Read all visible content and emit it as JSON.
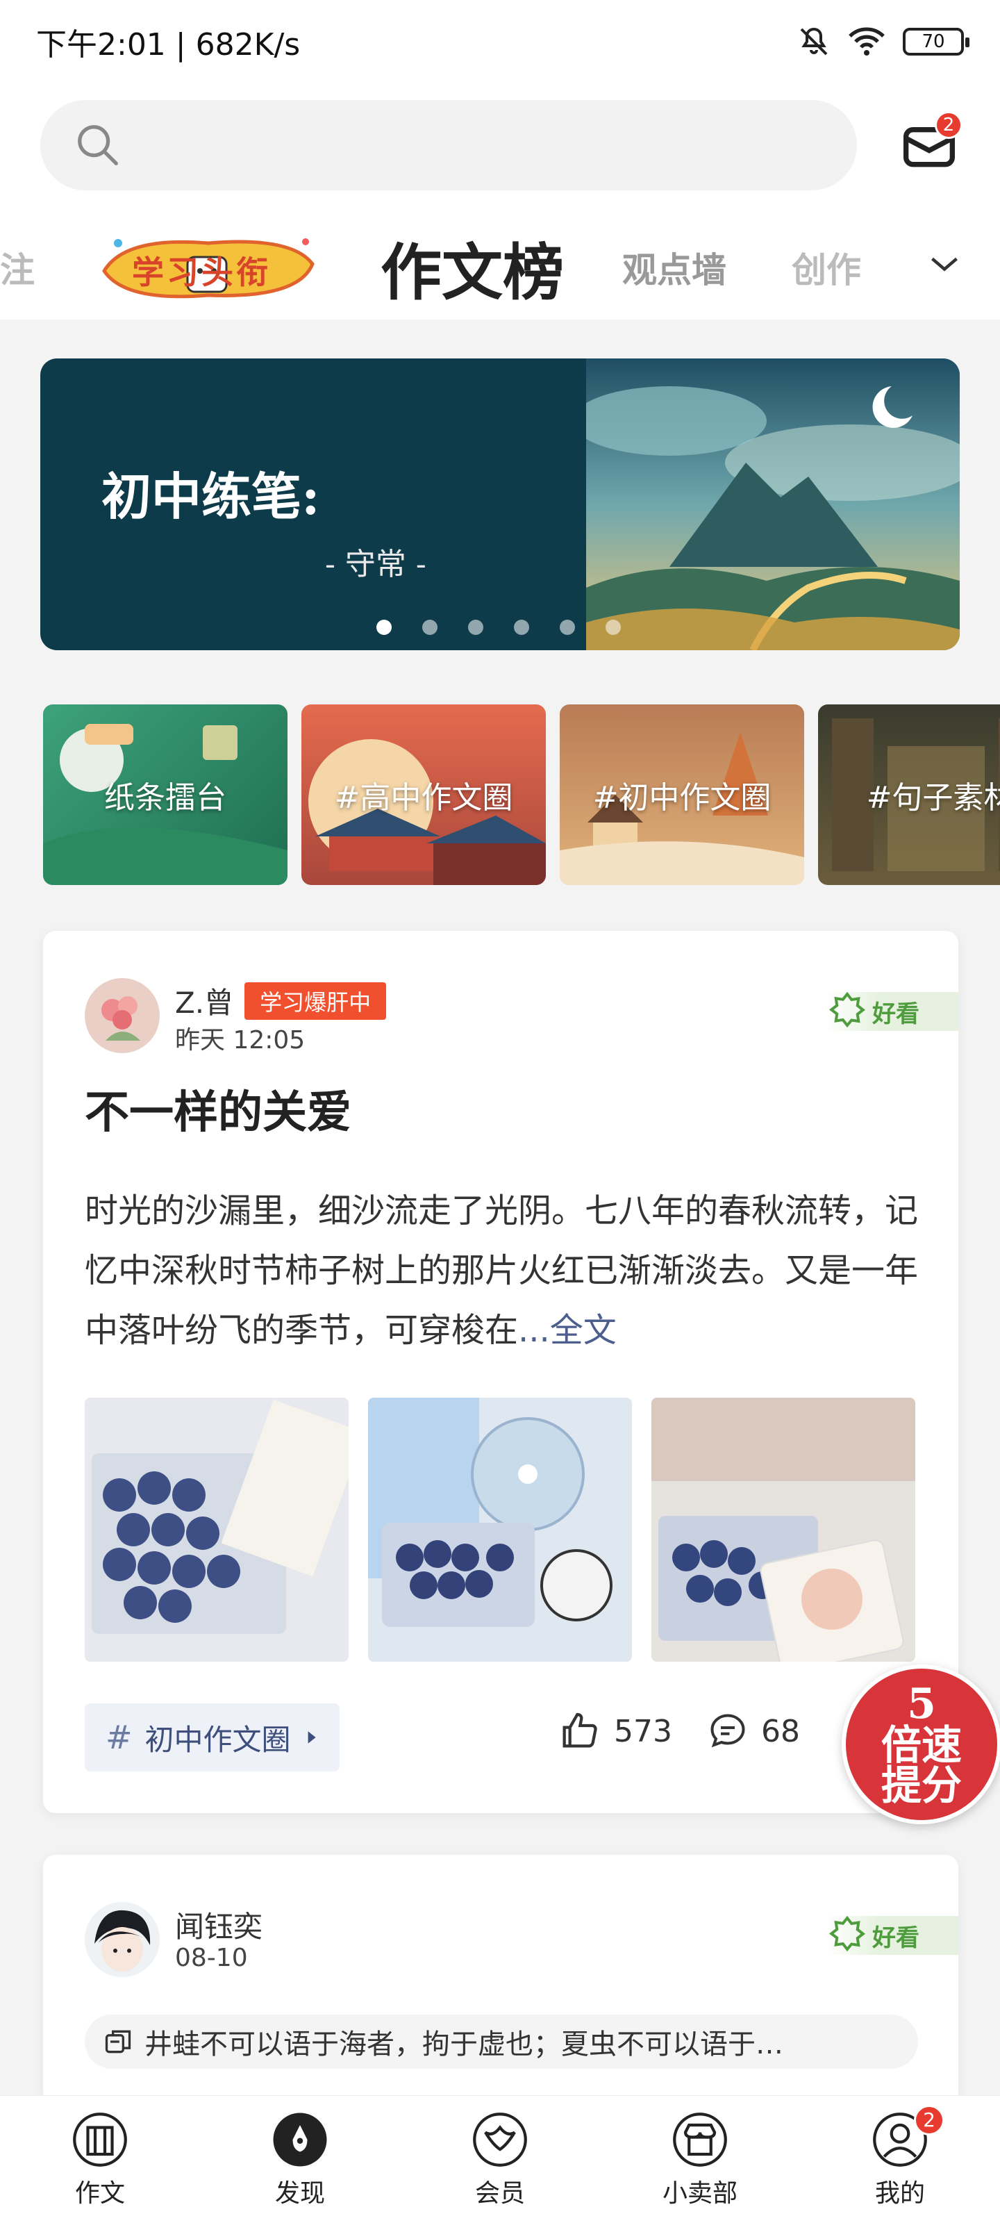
{
  "status_bar": {
    "time_speed": "下午2:01 | 682K/s",
    "battery": "70"
  },
  "header": {
    "mail_badge": "2",
    "logo_text": "学习头衔",
    "tabs": {
      "left_partial": "注",
      "active": "作文榜",
      "second": "观点墙",
      "third_partial": "创作"
    }
  },
  "banner": {
    "title": "初中练笔:",
    "subtitle": "- 守常 -",
    "dot_count": 6,
    "active_dot": 0
  },
  "topics": [
    {
      "label": "纸条擂台"
    },
    {
      "label": "#高中作文圈"
    },
    {
      "label": "#初中作文圈"
    },
    {
      "label": "#句子素材"
    }
  ],
  "post1": {
    "author": "Z.曾",
    "author_badge": "学习爆肝中",
    "time": "昨天 12:05",
    "good_tag": "好看",
    "title": "不一样的关爱",
    "text": "时光的沙漏里，细沙流走了光阴。七八年的春秋流转，记忆中深秋时节柿子树上的那片火红已渐渐淡去。又是一年中落叶纷飞的季节，可穿梭在",
    "more": "...全文",
    "topic_chip": "初中作文圈",
    "likes": "573",
    "comments": "68"
  },
  "post2": {
    "author": "闻钰奕",
    "time": "08-10",
    "good_tag": "好看",
    "quote": "井蛙不可以语于海者，拘于虚也；夏虫不可以语于…"
  },
  "boost": {
    "num": "5",
    "line1": "倍速",
    "line2": "提分"
  },
  "bottom_nav": [
    {
      "label": "作文"
    },
    {
      "label": "发现"
    },
    {
      "label": "会员"
    },
    {
      "label": "小卖部"
    },
    {
      "label": "我的",
      "badge": "2"
    }
  ],
  "colors": {
    "accent_red": "#e63b2e",
    "badge_orange": "#f0502e",
    "link_blue": "#4b5e8e",
    "good_green": "#4e9c3e",
    "banner_bg": "#0d3b4a"
  }
}
